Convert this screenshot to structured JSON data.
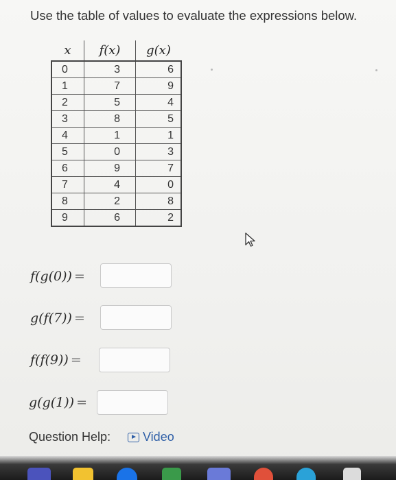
{
  "instruction": "Use the table of values to evaluate the expressions below.",
  "table": {
    "headers": [
      "x",
      "f(x)",
      "g(x)"
    ],
    "rows": [
      [
        "0",
        "3",
        "6"
      ],
      [
        "1",
        "7",
        "9"
      ],
      [
        "2",
        "5",
        "4"
      ],
      [
        "3",
        "8",
        "5"
      ],
      [
        "4",
        "1",
        "1"
      ],
      [
        "5",
        "0",
        "3"
      ],
      [
        "6",
        "9",
        "7"
      ],
      [
        "7",
        "4",
        "0"
      ],
      [
        "8",
        "2",
        "8"
      ],
      [
        "9",
        "6",
        "2"
      ]
    ]
  },
  "questions": [
    {
      "expression": "f(g(0))",
      "equals": "=",
      "value": ""
    },
    {
      "expression": "g(f(7))",
      "equals": "=",
      "value": ""
    },
    {
      "expression": "f(f(9))",
      "equals": "=",
      "value": ""
    },
    {
      "expression": "g(g(1))",
      "equals": "=",
      "value": ""
    }
  ],
  "help": {
    "label": "Question Help:",
    "video_label": "Video"
  },
  "colors": {
    "link": "#2f5fa7",
    "text": "#333333",
    "input_border": "#c9c9c9"
  }
}
